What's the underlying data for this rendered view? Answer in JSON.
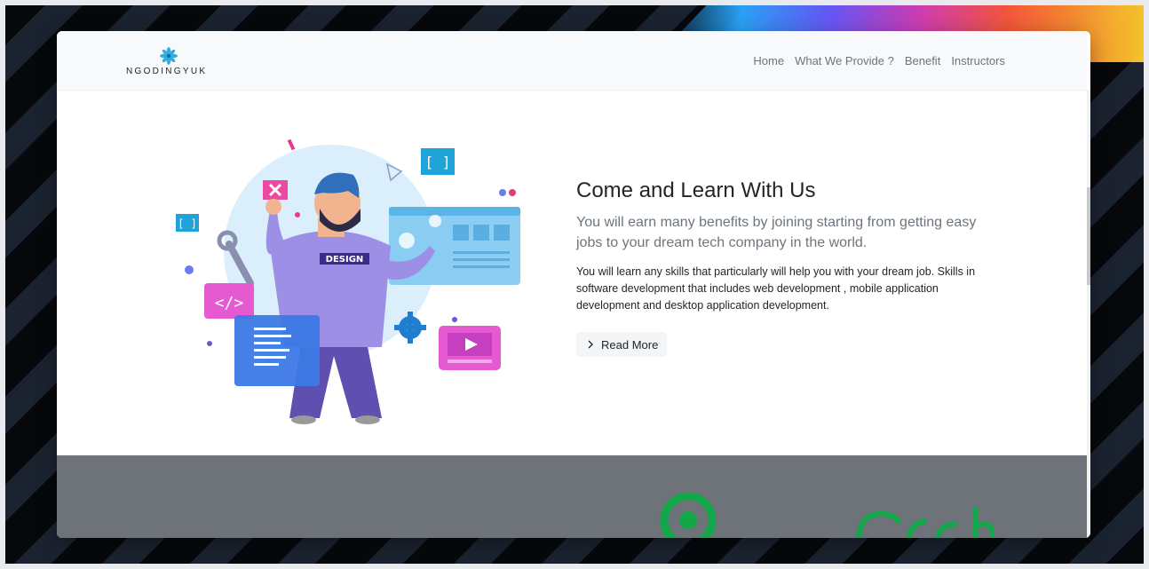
{
  "nav": {
    "brand": "NGODINGYUK",
    "links": [
      "Home",
      "What We Provide ?",
      "Benefit",
      "Instructors"
    ]
  },
  "hero": {
    "title": "Come and Learn With Us",
    "lead": "You will earn many benefits by joining starting from getting easy jobs to your dream tech company in the world.",
    "body": "You will learn any skills that particularly will help you with your dream job. Skills in software development that includes web development , mobile application development and desktop application development.",
    "button": "Read More",
    "illustration_badge": "DESIGN"
  },
  "colors": {
    "navbar_bg": "#f8f9fa",
    "band_bg": "#6d7378",
    "partner_green": "#12a84a",
    "logo_blue": "#1fa3d8"
  },
  "icons": [
    "flower-logo-icon",
    "chevron-right-icon",
    "code-icon",
    "play-icon",
    "gear-icon",
    "wrench-icon",
    "bracket-icon"
  ]
}
